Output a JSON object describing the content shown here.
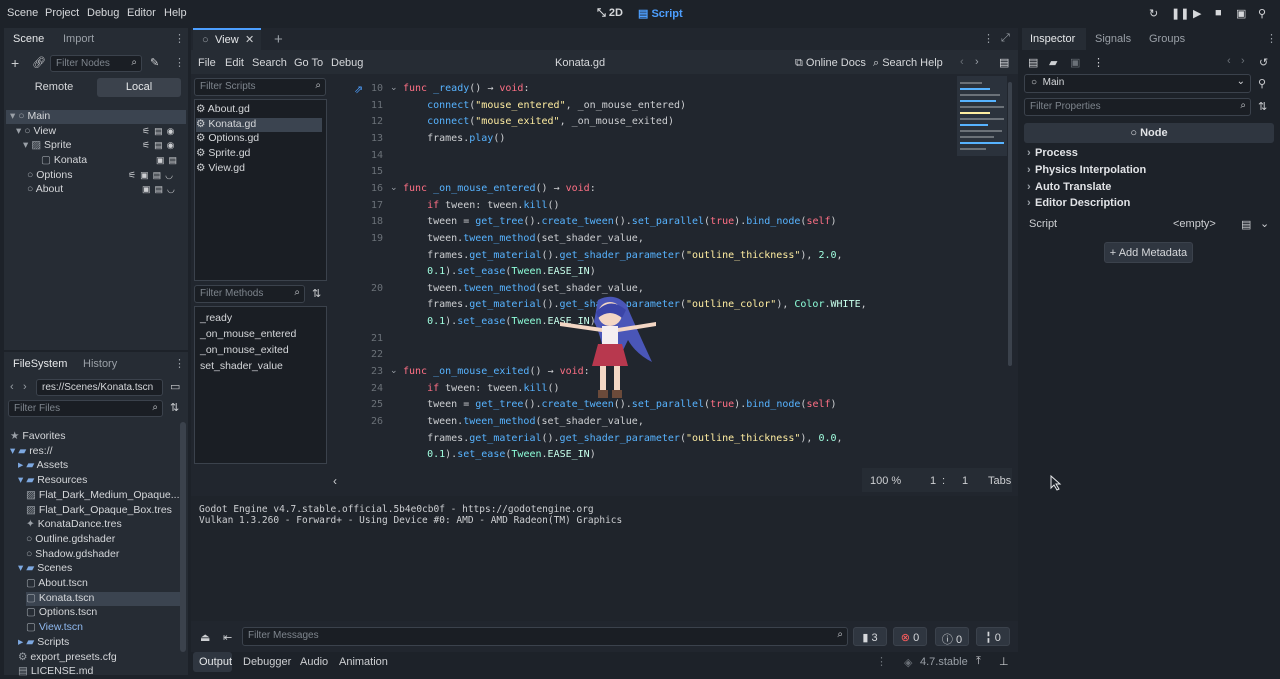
{
  "menubar": {
    "items": [
      "Scene",
      "Project",
      "Debug",
      "Editor",
      "Help"
    ],
    "mode_2d": "2D",
    "mode_script": "Script"
  },
  "scene_dock": {
    "tabs": [
      "Scene",
      "Import"
    ],
    "filter_placeholder": "Filter Nodes",
    "remote": "Remote",
    "local": "Local",
    "tree": [
      "Main",
      "View",
      "Sprite",
      "Konata",
      "Options",
      "About"
    ]
  },
  "filesystem_dock": {
    "tabs": [
      "FileSystem",
      "History"
    ],
    "path": "res://Scenes/Konata.tscn",
    "filter_placeholder": "Filter Files",
    "items": [
      "Favorites",
      "res://",
      "Assets",
      "Resources",
      "Flat_Dark_Medium_Opaque...",
      "Flat_Dark_Opaque_Box.tres",
      "KonataDance.tres",
      "Outline.gdshader",
      "Shadow.gdshader",
      "Scenes",
      "About.tscn",
      "Konata.tscn",
      "Options.tscn",
      "View.tscn",
      "Scripts",
      "export_presets.cfg",
      "LICENSE.md"
    ]
  },
  "editor_tabs": {
    "active": "View"
  },
  "script_menu": {
    "items": [
      "File",
      "Edit",
      "Search",
      "Go To",
      "Debug"
    ],
    "current_file": "Konata.gd",
    "online_docs": "Online Docs",
    "search_help": "Search Help"
  },
  "script_list": {
    "filter_placeholder": "Filter Scripts",
    "files": [
      "About.gd",
      "Konata.gd",
      "Options.gd",
      "Sprite.gd",
      "View.gd"
    ]
  },
  "method_list": {
    "filter_placeholder": "Filter Methods",
    "methods": [
      "_ready",
      "_on_mouse_entered",
      "_on_mouse_exited",
      "set_shader_value"
    ]
  },
  "code": {
    "line_numbers": [
      "10",
      "11",
      "12",
      "13",
      "14",
      "15",
      "16",
      "17",
      "18",
      "19",
      "",
      "",
      "20",
      "",
      "",
      "21",
      "22",
      "23",
      "24",
      "25",
      "26",
      "",
      ""
    ],
    "lines": [
      "func _ready() -> void:",
      "    connect(\"mouse_entered\", _on_mouse_entered)",
      "    connect(\"mouse_exited\", _on_mouse_exited)",
      "    frames.play()",
      "",
      "",
      "func _on_mouse_entered() -> void:",
      "    if tween: tween.kill()",
      "    tween = get_tree().create_tween().set_parallel(true).bind_node(self)",
      "    tween.tween_method(set_shader_value,",
      "    frames.get_material().get_shader_parameter(\"outline_thickness\"), 2.0,",
      "    0.1).set_ease(Tween.EASE_IN)",
      "    tween.tween_method(set_shader_value,",
      "    frames.get_material().get_shader_parameter(\"outline_color\"), Color.WHITE,",
      "    0.1).set_ease(Tween.EASE_IN)",
      "",
      "",
      "func _on_mouse_exited() -> void:",
      "    if tween: tween.kill()",
      "    tween = get_tree().create_tween().set_parallel(true).bind_node(self)",
      "    tween.tween_method(set_shader_value,",
      "    frames.get_material().get_shader_parameter(\"outline_thickness\"), 0.0,",
      "    0.1).set_ease(Tween.EASE_IN)"
    ],
    "zoom": "100 %",
    "line": "1",
    "col": "1",
    "indent": "Tabs"
  },
  "output": {
    "lines": [
      "Godot Engine v4.7.stable.official.5b4e0cb0f - https://godotengine.org",
      "Vulkan 1.3.260 - Forward+ - Using Device #0: AMD - AMD Radeon(TM) Graphics"
    ],
    "filter_placeholder": "Filter Messages",
    "count_messages": "3",
    "count_errors": "0",
    "count_warnings": "0",
    "count_info": "0"
  },
  "bottom_tabs": {
    "items": [
      "Output",
      "Debugger",
      "Audio",
      "Animation"
    ],
    "version": "4.7.stable"
  },
  "inspector": {
    "tabs": [
      "Inspector",
      "Signals",
      "Groups"
    ],
    "node_select": "Main",
    "filter_placeholder": "Filter Properties",
    "class_name": "Node",
    "sections": [
      "Process",
      "Physics Interpolation",
      "Auto Translate",
      "Editor Description"
    ],
    "script_label": "Script",
    "script_value": "<empty>",
    "add_metadata": "Add Metadata"
  },
  "colors": {
    "accent": "#4d9fff",
    "bg": "#1d2229",
    "panel": "#262c34",
    "keyword": "#ff7085",
    "string": "#ffeda1",
    "function": "#57b3ff"
  }
}
